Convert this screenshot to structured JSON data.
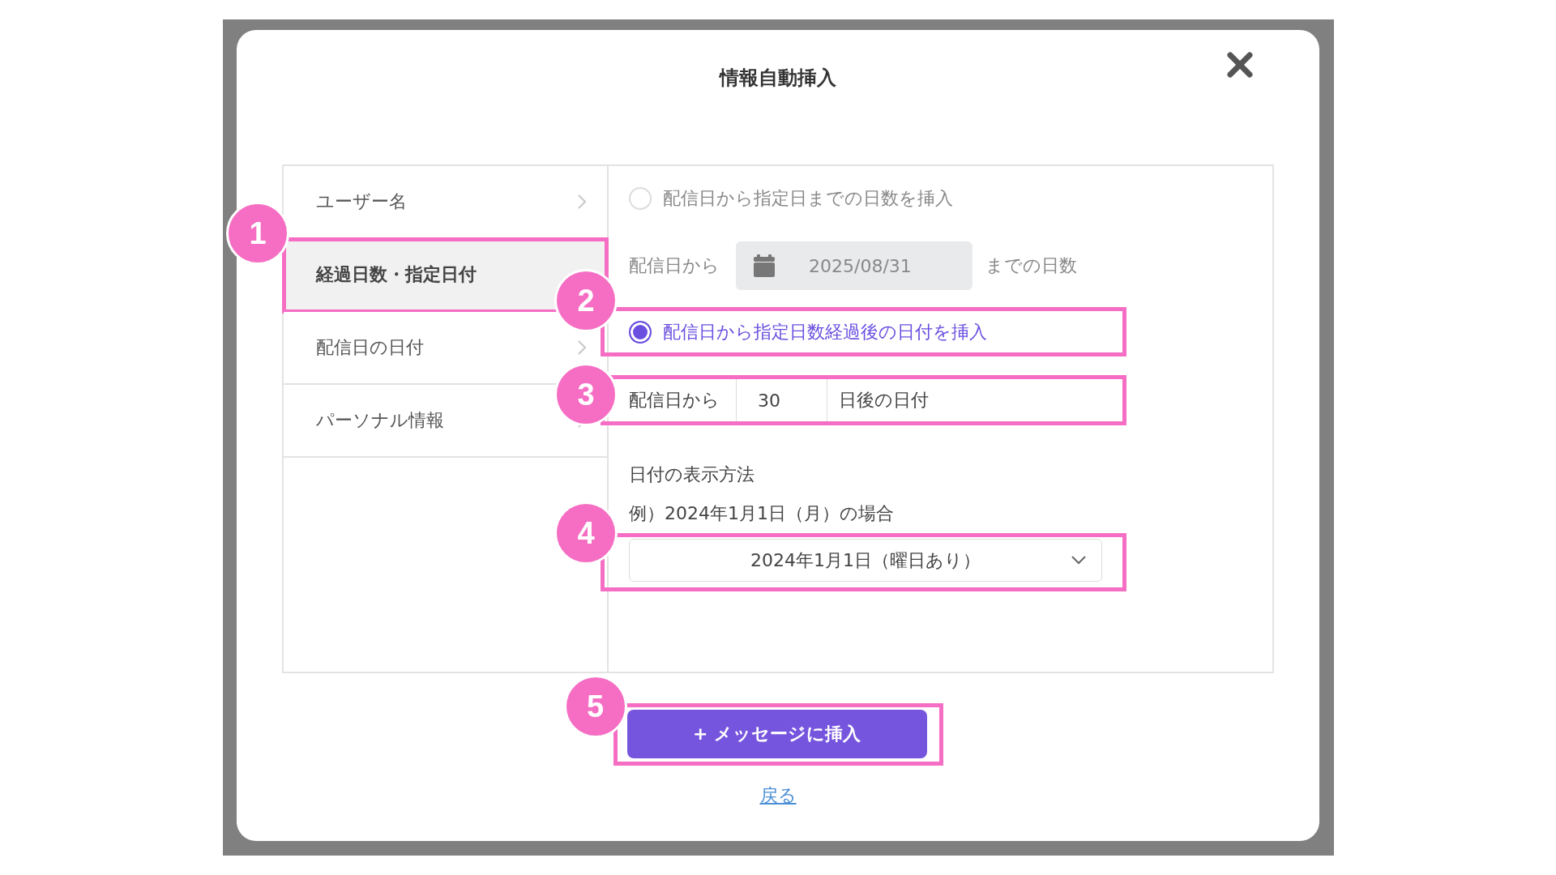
{
  "dialog": {
    "title": "情報自動挿入"
  },
  "menu": [
    {
      "label": "ユーザー名",
      "selected": false
    },
    {
      "label": "経過日数・指定日付",
      "selected": true,
      "callout": "1"
    },
    {
      "label": "配信日の日付",
      "selected": false
    },
    {
      "label": "パーソナル情報",
      "selected": false
    }
  ],
  "options": [
    {
      "label": "配信日から指定日までの日数を挿入",
      "selected": false
    },
    {
      "label": "配信日から指定日数経過後の日付を挿入",
      "selected": true,
      "callout": "2"
    }
  ],
  "until_row": {
    "prefix": "配信日から",
    "date": "2025/08/31",
    "suffix": "までの日数"
  },
  "after_row": {
    "prefix": "配信日から",
    "days": "30",
    "suffix": "日後の日付",
    "callout": "3"
  },
  "format": {
    "heading": "日付の表示方法",
    "example": "例）2024年1月1日（月）の場合",
    "value": "2024年1月1日（曜日あり）",
    "callout": "4"
  },
  "insert_button": {
    "label": "+ メッセージに挿入",
    "callout": "5"
  },
  "back_link": "戻る"
}
